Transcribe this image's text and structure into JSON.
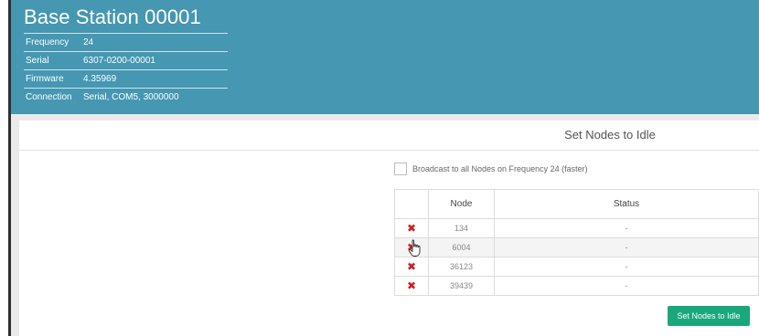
{
  "station": {
    "title": "Base Station 00001",
    "info": [
      {
        "key": "Frequency",
        "value": "24"
      },
      {
        "key": "Serial",
        "value": "6307-0200-00001"
      },
      {
        "key": "Firmware",
        "value": "4.35969"
      },
      {
        "key": "Connection",
        "value": "Serial, COM5, 3000000"
      }
    ]
  },
  "panel": {
    "title": "Set Nodes to Idle",
    "broadcast_label": "Broadcast to all Nodes on Frequency 24 (faster)",
    "broadcast_checked": false,
    "table": {
      "headers": [
        "",
        "Node",
        "Status"
      ],
      "rows": [
        {
          "delete_icon": "close-icon",
          "node": "134",
          "status": "-"
        },
        {
          "delete_icon": "close-icon",
          "node": "6004",
          "status": "-"
        },
        {
          "delete_icon": "close-icon",
          "node": "36123",
          "status": "-"
        },
        {
          "delete_icon": "close-icon",
          "node": "39439",
          "status": "-"
        }
      ]
    },
    "submit_label": "Set Nodes to Idle"
  },
  "colors": {
    "header_bg": "#4597b2",
    "accent_button": "#1aa77c",
    "delete_icon": "#cc1f1f"
  }
}
